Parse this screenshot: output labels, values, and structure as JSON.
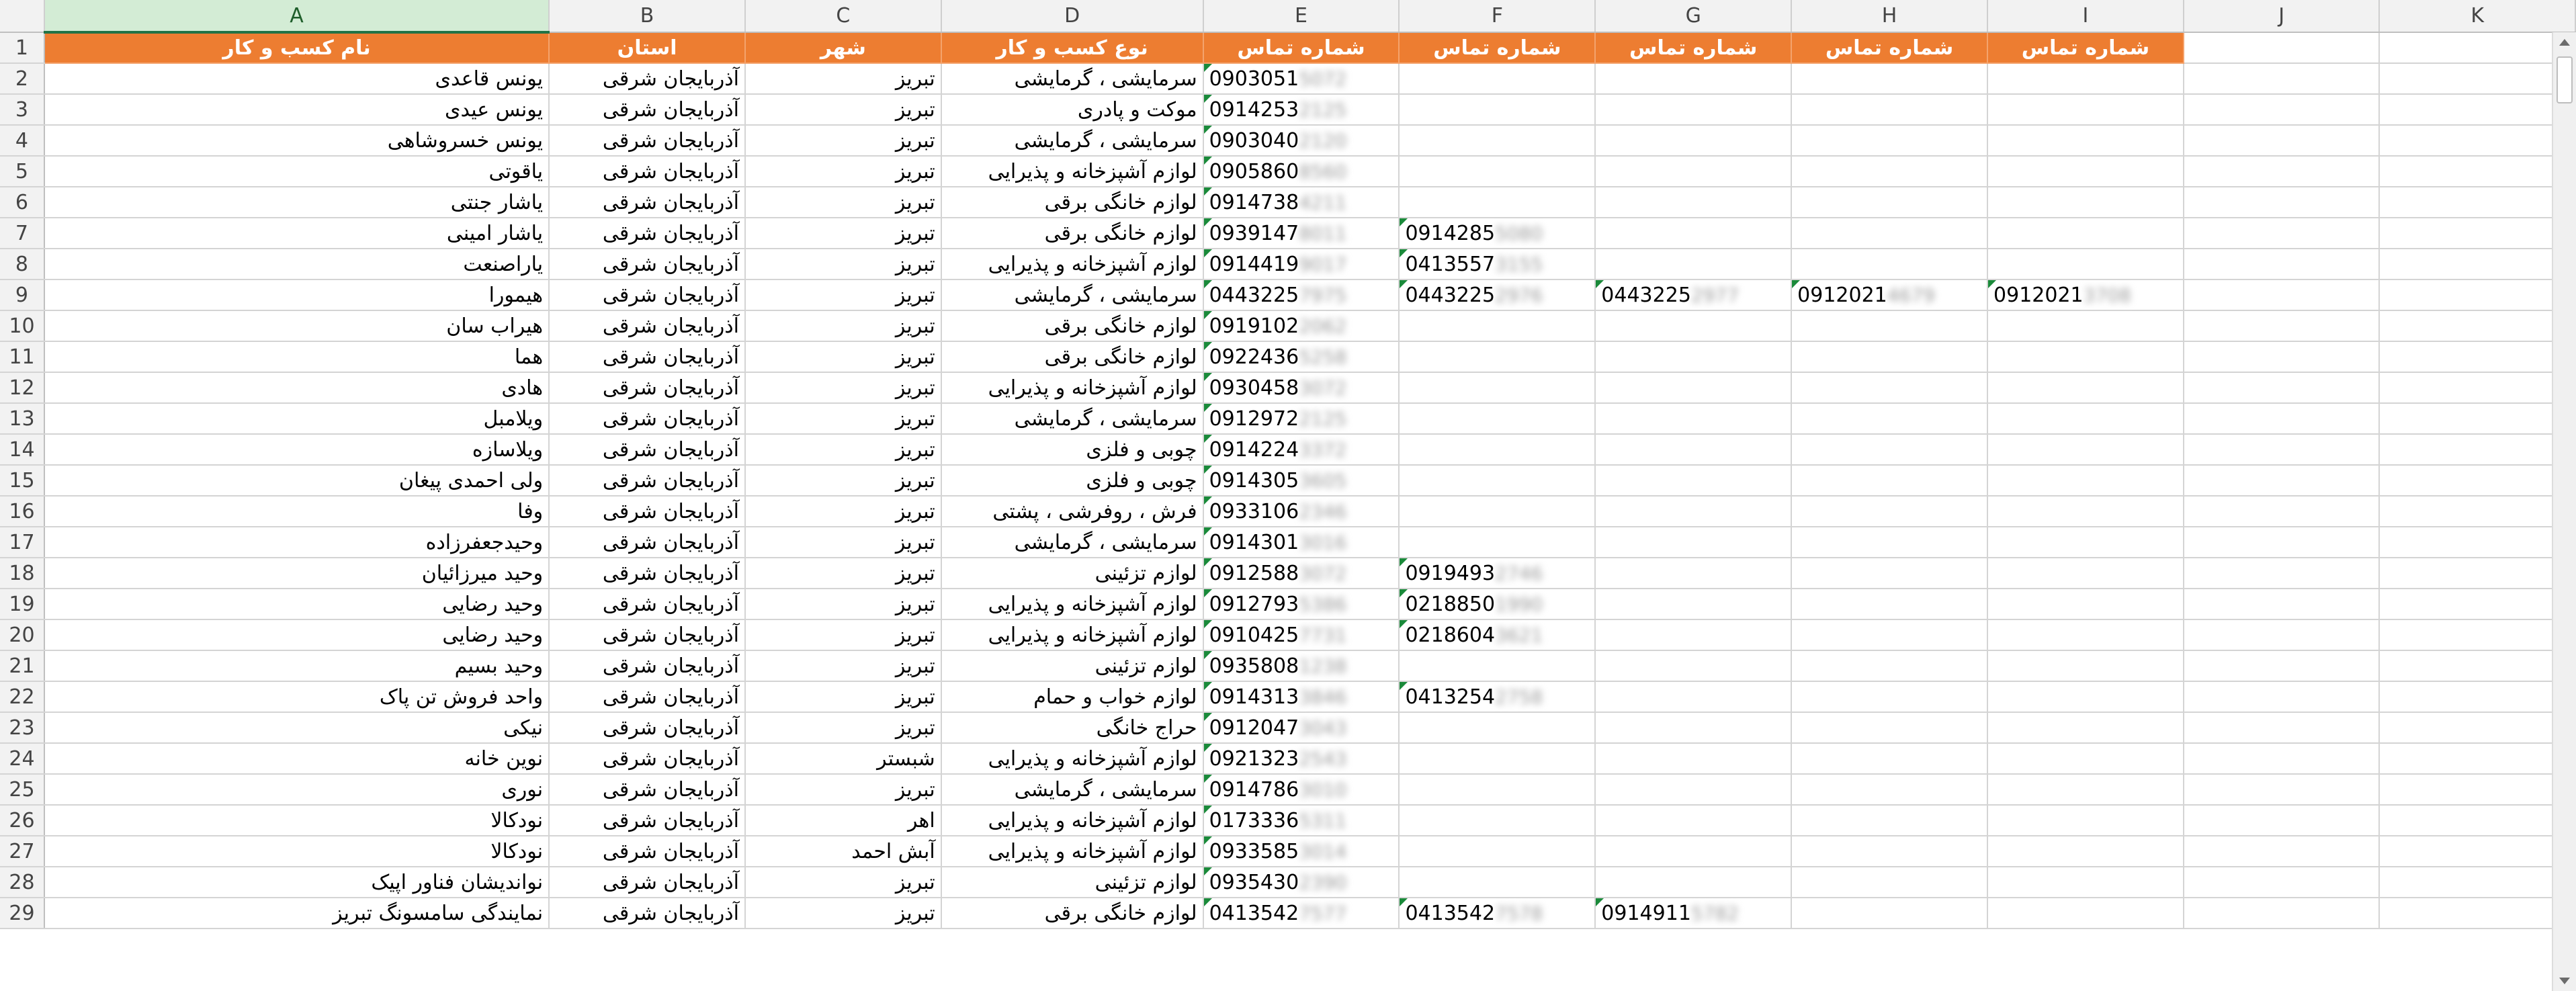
{
  "columns": [
    "A",
    "B",
    "C",
    "D",
    "E",
    "F",
    "G",
    "H",
    "I",
    "J",
    "K"
  ],
  "selected_column": "A",
  "header_row": [
    "نام کسب و کار",
    "استان",
    "شهر",
    "نوع کسب و کار",
    "شماره تماس",
    "شماره تماس",
    "شماره تماس",
    "شماره تماس",
    "شماره تماس",
    "",
    ""
  ],
  "rows": [
    {
      "n": "2",
      "name": "یونس قاعدی",
      "province": "آذربایجان شرقی",
      "city": "تبریز",
      "type": "سرمایشی ، گرمایشی",
      "phones": [
        [
          "0903051",
          "5072"
        ]
      ]
    },
    {
      "n": "3",
      "name": "یونس عیدی",
      "province": "آذربایجان شرقی",
      "city": "تبریز",
      "type": "موکت و پادری",
      "phones": [
        [
          "0914253",
          "2125"
        ]
      ]
    },
    {
      "n": "4",
      "name": "یونس خسروشاهی",
      "province": "آذربایجان شرقی",
      "city": "تبریز",
      "type": "سرمایشی ، گرمایشی",
      "phones": [
        [
          "0903040",
          "2120"
        ]
      ]
    },
    {
      "n": "5",
      "name": "یاقوتی",
      "province": "آذربایجان شرقی",
      "city": "تبریز",
      "type": "لوازم آشپزخانه و پذیرایی",
      "phones": [
        [
          "0905860",
          "8560"
        ]
      ]
    },
    {
      "n": "6",
      "name": "یاشار جنتی",
      "province": "آذربایجان شرقی",
      "city": "تبریز",
      "type": "لوازم خانگی برقی",
      "phones": [
        [
          "0914738",
          "4211"
        ]
      ]
    },
    {
      "n": "7",
      "name": "یاشار امینی",
      "province": "آذربایجان شرقی",
      "city": "تبریز",
      "type": "لوازم خانگی برقی",
      "phones": [
        [
          "0939147",
          "8011"
        ],
        [
          "0914285",
          "5080"
        ]
      ]
    },
    {
      "n": "8",
      "name": "یاراصنعت",
      "province": "آذربایجان شرقی",
      "city": "تبریز",
      "type": "لوازم آشپزخانه و پذیرایی",
      "phones": [
        [
          "0914419",
          "9017"
        ],
        [
          "0413557",
          "3155"
        ]
      ]
    },
    {
      "n": "9",
      "name": "هیمورا",
      "province": "آذربایجان شرقی",
      "city": "تبریز",
      "type": "سرمایشی ، گرمایشی",
      "phones": [
        [
          "0443225",
          "7975"
        ],
        [
          "0443225",
          "2976"
        ],
        [
          "0443225",
          "2977"
        ],
        [
          "0912021",
          "4679"
        ],
        [
          "0912021",
          "3708"
        ]
      ]
    },
    {
      "n": "10",
      "name": "هیراب سان",
      "province": "آذربایجان شرقی",
      "city": "تبریز",
      "type": "لوازم خانگی برقی",
      "phones": [
        [
          "0919102",
          "2062"
        ]
      ]
    },
    {
      "n": "11",
      "name": "هما",
      "province": "آذربایجان شرقی",
      "city": "تبریز",
      "type": "لوازم خانگی برقی",
      "phones": [
        [
          "0922436",
          "5258"
        ]
      ]
    },
    {
      "n": "12",
      "name": "هادی",
      "province": "آذربایجان شرقی",
      "city": "تبریز",
      "type": "لوازم آشپزخانه و پذیرایی",
      "phones": [
        [
          "0930458",
          "3072"
        ]
      ]
    },
    {
      "n": "13",
      "name": "ویلامبل",
      "province": "آذربایجان شرقی",
      "city": "تبریز",
      "type": "سرمایشی ، گرمایشی",
      "phones": [
        [
          "0912972",
          "2125"
        ]
      ]
    },
    {
      "n": "14",
      "name": "ویلاسازه",
      "province": "آذربایجان شرقی",
      "city": "تبریز",
      "type": "چوبی و فلزی",
      "phones": [
        [
          "0914224",
          "3372"
        ]
      ]
    },
    {
      "n": "15",
      "name": "ولی احمدی پیغان",
      "province": "آذربایجان شرقی",
      "city": "تبریز",
      "type": "چوبی و فلزی",
      "phones": [
        [
          "0914305",
          "3605"
        ]
      ]
    },
    {
      "n": "16",
      "name": "وفا",
      "province": "آذربایجان شرقی",
      "city": "تبریز",
      "type": "فرش ، روفرشی ، پشتی",
      "phones": [
        [
          "0933106",
          "2346"
        ]
      ]
    },
    {
      "n": "17",
      "name": "وحیدجعفرزاده",
      "province": "آذربایجان شرقی",
      "city": "تبریز",
      "type": "سرمایشی ، گرمایشی",
      "phones": [
        [
          "0914301",
          "3016"
        ]
      ]
    },
    {
      "n": "18",
      "name": "وحید میرزائیان",
      "province": "آذربایجان شرقی",
      "city": "تبریز",
      "type": "لوازم تزئینی",
      "phones": [
        [
          "0912588",
          "3072"
        ],
        [
          "0919493",
          "2746"
        ]
      ]
    },
    {
      "n": "19",
      "name": "وحید رضایی",
      "province": "آذربایجان شرقی",
      "city": "تبریز",
      "type": "لوازم آشپزخانه و پذیرایی",
      "phones": [
        [
          "0912793",
          "5386"
        ],
        [
          "0218850",
          "1990"
        ]
      ]
    },
    {
      "n": "20",
      "name": "وحید رضایی",
      "province": "آذربایجان شرقی",
      "city": "تبریز",
      "type": "لوازم آشپزخانه و پذیرایی",
      "phones": [
        [
          "0910425",
          "7731"
        ],
        [
          "0218604",
          "3621"
        ]
      ]
    },
    {
      "n": "21",
      "name": "وحید بسیم",
      "province": "آذربایجان شرقی",
      "city": "تبریز",
      "type": "لوازم تزئینی",
      "phones": [
        [
          "0935808",
          "1238"
        ]
      ]
    },
    {
      "n": "22",
      "name": "واحد فروش تن پاک",
      "province": "آذربایجان شرقی",
      "city": "تبریز",
      "type": "لوازم خواب و حمام",
      "phones": [
        [
          "0914313",
          "3846"
        ],
        [
          "0413254",
          "2758"
        ]
      ]
    },
    {
      "n": "23",
      "name": "نیکی",
      "province": "آذربایجان شرقی",
      "city": "تبریز",
      "type": "حراج خانگی",
      "phones": [
        [
          "0912047",
          "3043"
        ]
      ]
    },
    {
      "n": "24",
      "name": "نوین خانه",
      "province": "آذربایجان شرقی",
      "city": "شبستر",
      "type": "لوازم آشپزخانه و پذیرایی",
      "phones": [
        [
          "0921323",
          "2543"
        ]
      ]
    },
    {
      "n": "25",
      "name": "نوری",
      "province": "آذربایجان شرقی",
      "city": "تبریز",
      "type": "سرمایشی ، گرمایشی",
      "phones": [
        [
          "0914786",
          "3010"
        ]
      ]
    },
    {
      "n": "26",
      "name": "نودکالا",
      "province": "آذربایجان شرقی",
      "city": "اهر",
      "type": "لوازم آشپزخانه و پذیرایی",
      "phones": [
        [
          "0173336",
          "5311"
        ]
      ]
    },
    {
      "n": "27",
      "name": "نودکالا",
      "province": "آذربایجان شرقی",
      "city": "آبش احمد",
      "type": "لوازم آشپزخانه و پذیرایی",
      "phones": [
        [
          "0933585",
          "3014"
        ]
      ]
    },
    {
      "n": "28",
      "name": "نواندیشان فناور اپیک",
      "province": "آذربایجان شرقی",
      "city": "تبریز",
      "type": "لوازم تزئینی",
      "phones": [
        [
          "0935430",
          "2390"
        ]
      ]
    },
    {
      "n": "29",
      "name": "نمایندگی سامسونگ تبریز",
      "province": "آذربایجان شرقی",
      "city": "تبریز",
      "type": "لوازم خانگی برقی",
      "phones": [
        [
          "0413542",
          "7577"
        ],
        [
          "0413542",
          "7578"
        ],
        [
          "0914911",
          "5782"
        ]
      ]
    }
  ]
}
